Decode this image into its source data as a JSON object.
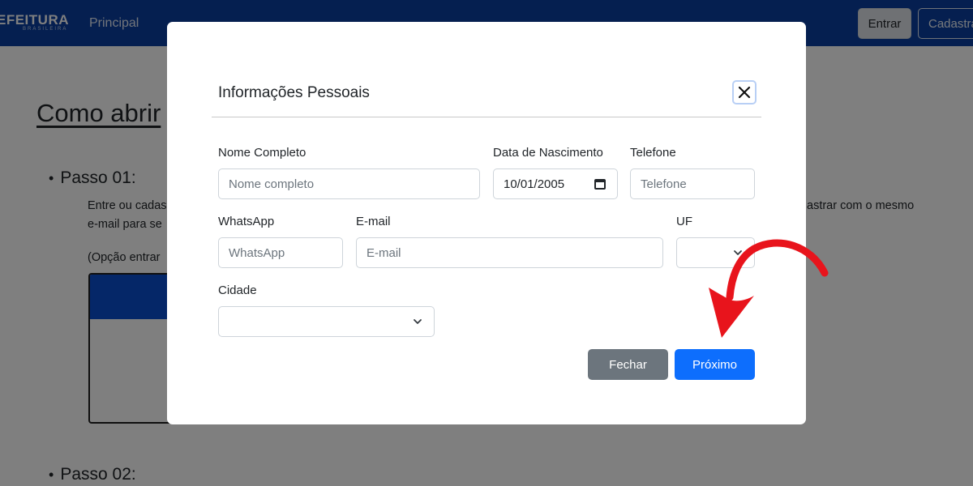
{
  "navbar": {
    "brand": "EFEITURA",
    "brand_sub": "BRASILEIRA",
    "link_principal": "Principal",
    "btn_entrar": "Entrar",
    "btn_cadastrar": "Cadastrar"
  },
  "background": {
    "title": "Como abrir",
    "step1": "Passo 01:",
    "step1_line1_left": "Entre ou cadas",
    "step1_line1_right": "astrar com o mesmo",
    "step1_line2": "e-mail para se",
    "option_text": "(Opção entrar",
    "step2": "Passo 02:"
  },
  "modal": {
    "title": "Informações Pessoais",
    "fields": {
      "nome_label": "Nome Completo",
      "nome_placeholder": "Nome completo",
      "nascimento_label": "Data de Nascimento",
      "nascimento_value": "10/01/2005",
      "telefone_label": "Telefone",
      "telefone_placeholder": "Telefone",
      "whatsapp_label": "WhatsApp",
      "whatsapp_placeholder": "WhatsApp",
      "email_label": "E-mail",
      "email_placeholder": "E-mail",
      "uf_label": "UF",
      "cidade_label": "Cidade"
    },
    "buttons": {
      "fechar": "Fechar",
      "proximo": "Próximo"
    }
  },
  "colors": {
    "navbar": "#0a3fa0",
    "primary": "#0d6efd",
    "secondary": "#6c757d",
    "annotation_arrow": "#e8141c"
  },
  "icons": [
    "close-icon",
    "calendar-icon",
    "chevron-down-icon",
    "annotation-arrow"
  ]
}
